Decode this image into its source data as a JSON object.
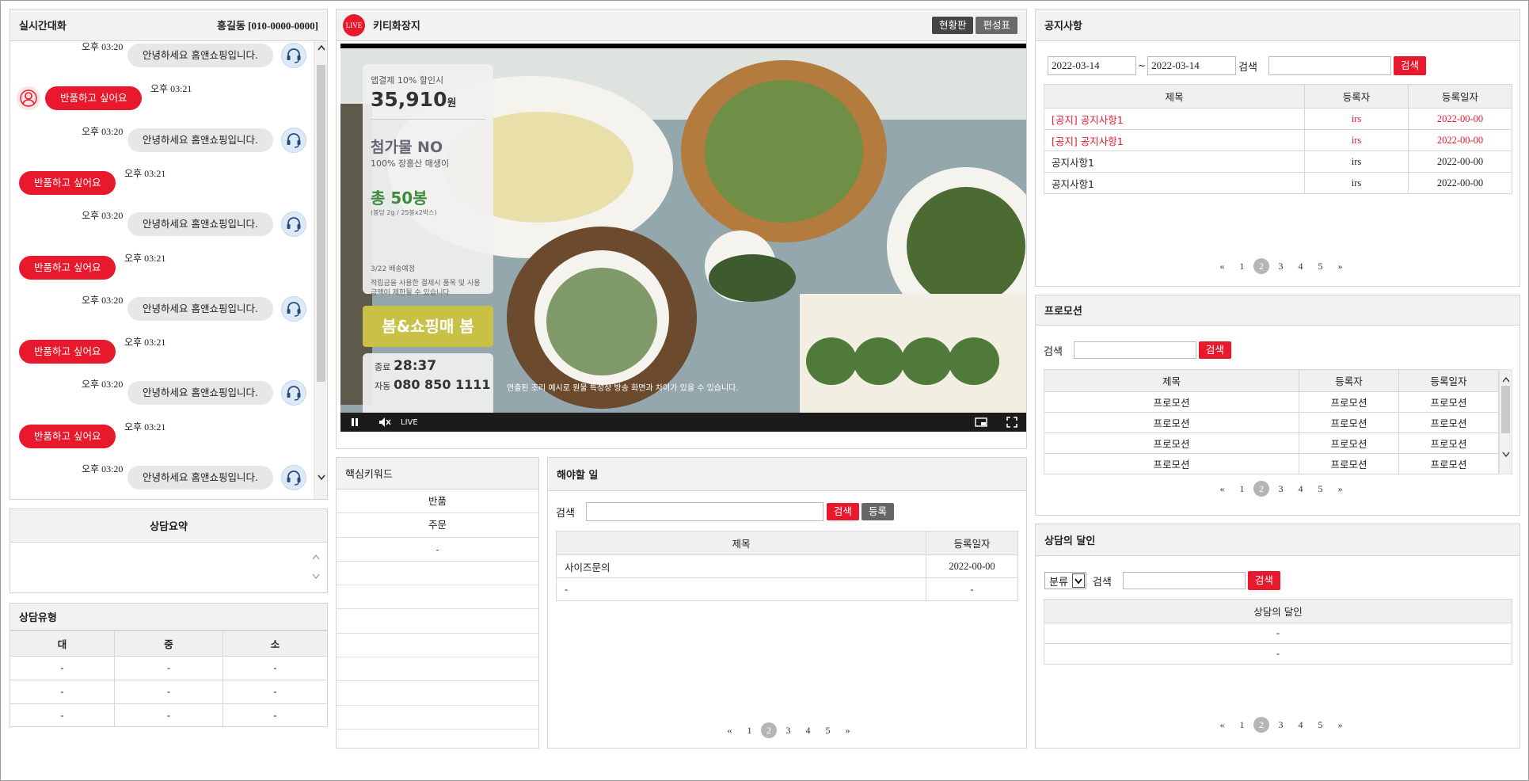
{
  "chat": {
    "title": "실시간대화",
    "customer": "홍길동 [010-0000-0000]",
    "messages": [
      {
        "from": "agent",
        "time": "오후 03:20",
        "text": "안녕하세요 홈앤쇼핑입니다."
      },
      {
        "from": "customer",
        "time": "오후 03:21",
        "text": "반품하고 싶어요"
      },
      {
        "from": "agent",
        "time": "오후 03:20",
        "text": "안녕하세요 홈앤쇼핑입니다."
      },
      {
        "from": "customer",
        "time": "오후 03:21",
        "text": "반품하고 싶어요"
      },
      {
        "from": "agent",
        "time": "오후 03:20",
        "text": "안녕하세요 홈앤쇼핑입니다."
      },
      {
        "from": "customer",
        "time": "오후 03:21",
        "text": "반품하고 싶어요"
      },
      {
        "from": "agent",
        "time": "오후 03:20",
        "text": "안녕하세요 홈앤쇼핑입니다."
      },
      {
        "from": "customer",
        "time": "오후 03:21",
        "text": "반품하고 싶어요"
      },
      {
        "from": "agent",
        "time": "오후 03:20",
        "text": "안녕하세요 홈앤쇼핑입니다."
      },
      {
        "from": "customer",
        "time": "오후 03:21",
        "text": "반품하고 싶어요"
      },
      {
        "from": "agent",
        "time": "오후 03:20",
        "text": "안녕하세요 홈앤쇼핑입니다."
      }
    ]
  },
  "summary": {
    "title": "상담요약"
  },
  "consult_type": {
    "title": "상담유형",
    "headers": [
      "대",
      "중",
      "소"
    ],
    "rows": [
      [
        "-",
        "-",
        "-"
      ],
      [
        "-",
        "-",
        "-"
      ],
      [
        "-",
        "-",
        "-"
      ]
    ]
  },
  "live": {
    "badge": "LIVE",
    "title": "키티화장지",
    "btn_status": "현황판",
    "btn_schedule": "편성표",
    "overlay": {
      "discount": "앱결제 10% 할인시",
      "price": "35,910",
      "price_unit": "원",
      "no_additive": "첨가물 NO",
      "origin": "100% 장흥산 매생이",
      "total": "총 50봉",
      "total_sub": "(봉당 2g / 25봉x2박스)",
      "delivery": "3/22 배송예정",
      "notice": "적립금을 사용한 결제시 품목 및 사용 금액이 제한될 수 있습니다",
      "promo": "봄&쇼핑매 봄",
      "end_label": "종료",
      "end_time": "28:37",
      "phone_label": "자동",
      "phone": "080 850 1111",
      "disclaimer": "연출된 조리 예시로 원물 특성상 방송 화면과 차이가 있을 수 있습니다."
    },
    "player_live": "LIVE"
  },
  "keywords": {
    "title": "핵심키워드",
    "items": [
      "반품",
      "주문",
      "-",
      "",
      "",
      "",
      "",
      "",
      "",
      "",
      ""
    ]
  },
  "todo": {
    "title": "해야할 일",
    "search_label": "검색",
    "btn_search": "검색",
    "btn_register": "등록",
    "headers": [
      "제목",
      "등록일자"
    ],
    "rows": [
      [
        "사이즈문의",
        "2022-00-00"
      ],
      [
        "-",
        "-"
      ]
    ],
    "pages": [
      "«",
      "1",
      "2",
      "3",
      "4",
      "5",
      "»"
    ]
  },
  "notice": {
    "title": "공지사항",
    "date_from": "2022-03-14",
    "date_sep": "~",
    "date_to": "2022-03-14",
    "search_label": "검색",
    "btn_search": "검색",
    "headers": [
      "제목",
      "등록자",
      "등록일자"
    ],
    "rows": [
      {
        "title": "[공지] 공지사항1",
        "author": "irs",
        "date": "2022-00-00",
        "highlight": true
      },
      {
        "title": "[공지] 공지사항1",
        "author": "irs",
        "date": "2022-00-00",
        "highlight": true
      },
      {
        "title": "공지사항1",
        "author": "irs",
        "date": "2022-00-00",
        "highlight": false
      },
      {
        "title": "공지사항1",
        "author": "irs",
        "date": "2022-00-00",
        "highlight": false
      }
    ],
    "pages": [
      "«",
      "1",
      "2",
      "3",
      "4",
      "5",
      "»"
    ]
  },
  "promotion": {
    "title": "프로모션",
    "search_label": "검색",
    "btn_search": "검색",
    "headers": [
      "제목",
      "등록자",
      "등록일자"
    ],
    "rows": [
      [
        "프로모션",
        "프로모션",
        "프로모션"
      ],
      [
        "프로모션",
        "프로모션",
        "프로모션"
      ],
      [
        "프로모션",
        "프로모션",
        "프로모션"
      ],
      [
        "프로모션",
        "프로모션",
        "프로모션"
      ]
    ],
    "pages": [
      "«",
      "1",
      "2",
      "3",
      "4",
      "5",
      "»"
    ]
  },
  "master": {
    "title": "상담의 달인",
    "category": "분류",
    "search_label": "검색",
    "btn_search": "검색",
    "headers": [
      "상담의 달인"
    ],
    "rows": [
      "-",
      "-"
    ],
    "pages": [
      "«",
      "1",
      "2",
      "3",
      "4",
      "5",
      "»"
    ]
  },
  "colors": {
    "accent": "#e8192c",
    "header_bg": "#f2f2f2"
  }
}
